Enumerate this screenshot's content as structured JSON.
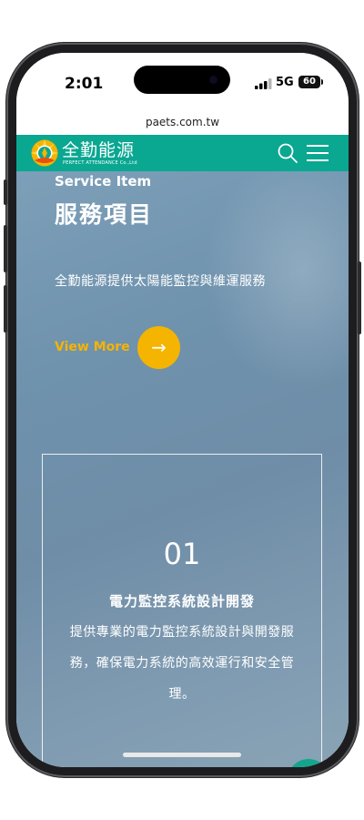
{
  "status": {
    "time": "2:01",
    "network": "5G",
    "battery": "60"
  },
  "browser": {
    "url": "paets.com.tw"
  },
  "header": {
    "logo_text": "全勤能源",
    "logo_subtitle": "PERFECT ATTENDANCE Co.,Ltd",
    "icons": [
      "search-icon",
      "hamburger-menu-icon"
    ]
  },
  "hero": {
    "eyebrow": "Service Item",
    "title": "服務項目",
    "description": "全勤能源提供太陽能監控與維運服務",
    "view_more_label": "View More",
    "view_more_icon": "→"
  },
  "service_card": {
    "number": "01",
    "title": "電力監控系統設計開發",
    "description": "提供專業的電力監控系統設計與開發服務，確保電力系統的高效運行和安全管理。"
  },
  "back_to_top_icon": "arrow-up-icon",
  "colors": {
    "brand_teal": "#0aa791",
    "accent_yellow": "#f5b400",
    "back_top_teal": "#14a58e"
  }
}
